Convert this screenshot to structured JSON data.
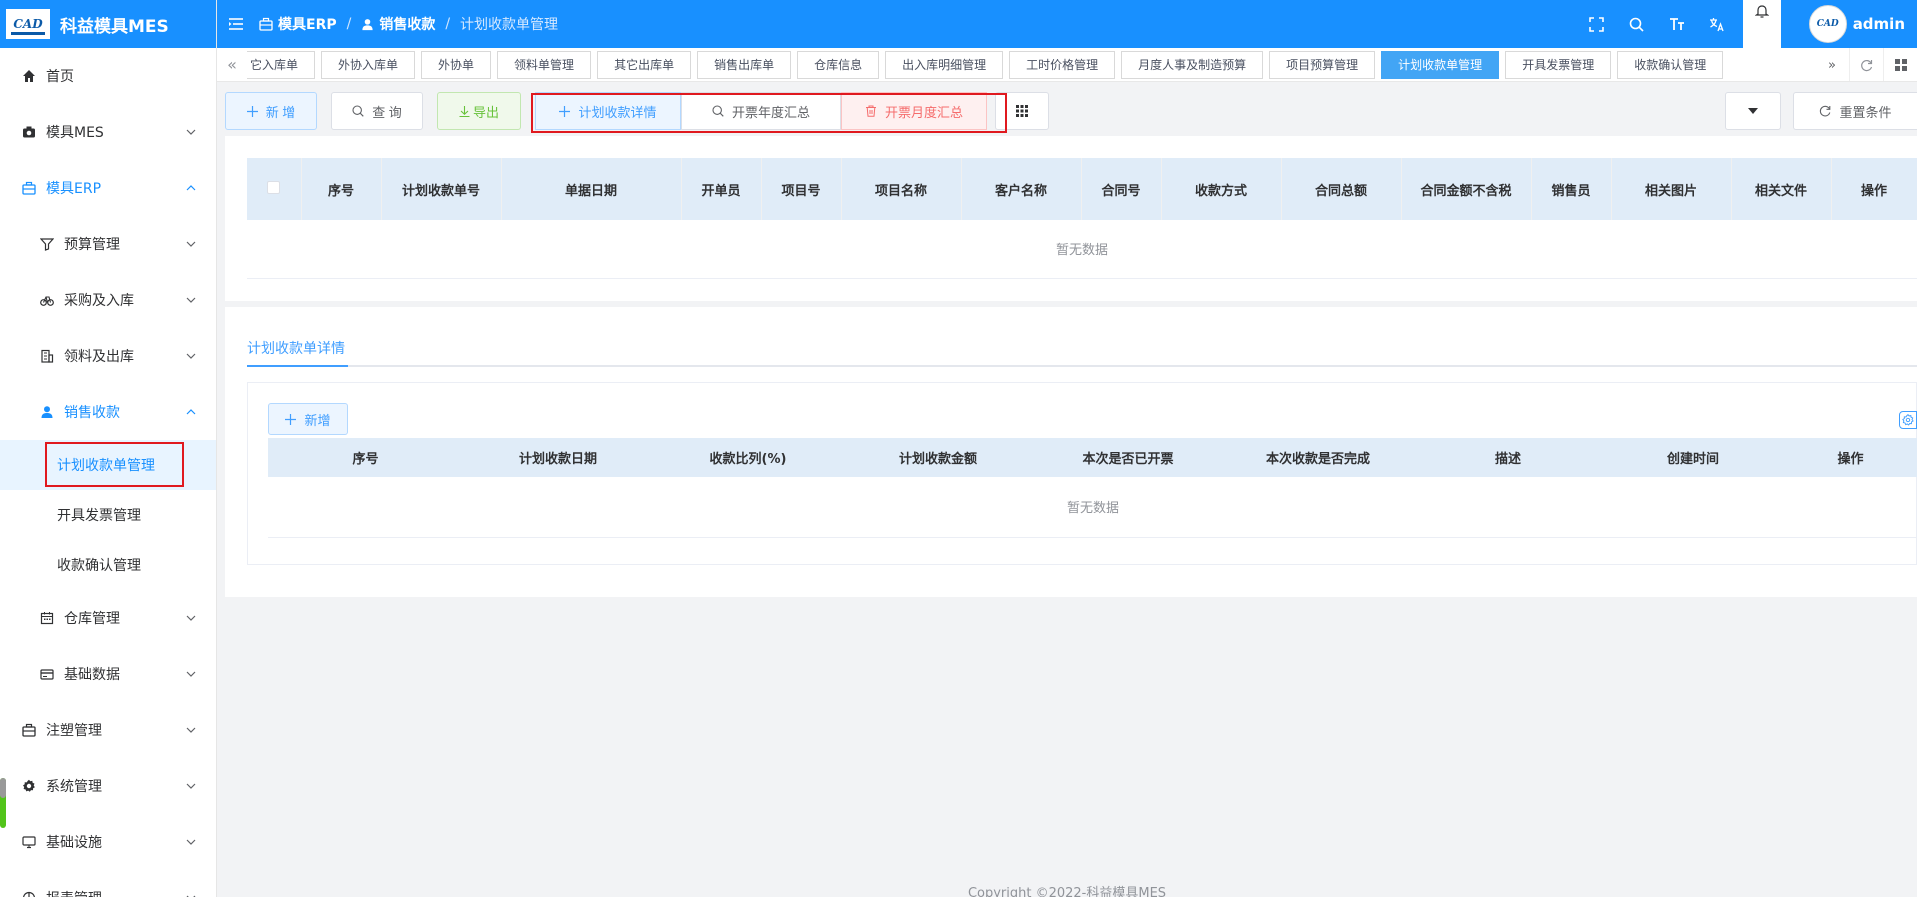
{
  "app": {
    "logo_text": "CAD",
    "title": "科益模具MES"
  },
  "sidebar": {
    "items": [
      {
        "label": "首页",
        "icon": "home-icon"
      },
      {
        "label": "模具MES",
        "icon": "camera-icon"
      },
      {
        "label": "模具ERP",
        "icon": "briefcase-icon"
      },
      {
        "label": "预算管理",
        "icon": "funnel-icon"
      },
      {
        "label": "采购及入库",
        "icon": "bicycle-icon"
      },
      {
        "label": "领料及出库",
        "icon": "building-icon"
      },
      {
        "label": "销售收款",
        "icon": "user-icon"
      },
      {
        "label": "计划收款单管理"
      },
      {
        "label": "开具发票管理"
      },
      {
        "label": "收款确认管理"
      },
      {
        "label": "仓库管理",
        "icon": "calendar-icon"
      },
      {
        "label": "基础数据",
        "icon": "card-icon"
      },
      {
        "label": "注塑管理",
        "icon": "briefcase-icon"
      },
      {
        "label": "系统管理",
        "icon": "gear-icon"
      },
      {
        "label": "基础设施",
        "icon": "monitor-icon"
      },
      {
        "label": "报表管理",
        "icon": "pie-icon"
      }
    ]
  },
  "header": {
    "breadcrumb": [
      "模具ERP",
      "销售收款",
      "计划收款单管理"
    ],
    "username": "admin",
    "avatar_text": "CAD"
  },
  "tabs": {
    "items": [
      "它入库单",
      "外协入库单",
      "外协单",
      "领料单管理",
      "其它出库单",
      "销售出库单",
      "仓库信息",
      "出入库明细管理",
      "工时价格管理",
      "月度人事及制造预算",
      "项目预算管理",
      "计划收款单管理",
      "开具发票管理",
      "收款确认管理"
    ],
    "active": "计划收款单管理"
  },
  "toolbar": {
    "add": "新 增",
    "query": "查 询",
    "export": "导出",
    "plan_detail": "计划收款详情",
    "invoice_year": "开票年度汇总",
    "invoice_month": "开票月度汇总",
    "reset": "重置条件"
  },
  "main_table": {
    "columns": [
      "序号",
      "计划收款单号",
      "单据日期",
      "开单员",
      "项目号",
      "项目名称",
      "客户名称",
      "合同号",
      "收款方式",
      "合同总额",
      "合同金额不含税",
      "销售员",
      "相关图片",
      "相关文件",
      "操作"
    ],
    "empty_text": "暂无数据"
  },
  "detail": {
    "tab_label": "计划收款单详情",
    "add": "新增",
    "columns": [
      "序号",
      "计划收款日期",
      "收款比列(%)",
      "计划收款金额",
      "本次是否已开票",
      "本次收款是否完成",
      "描述",
      "创建时间",
      "操作"
    ],
    "empty_text": "暂无数据"
  },
  "footer": {
    "copyright": "Copyright ©2022-科益模具MES"
  },
  "colors": {
    "primary": "#1890ff",
    "highlight_frame": "#e0191f",
    "success": "#67c23a",
    "danger": "#f56c6c"
  }
}
